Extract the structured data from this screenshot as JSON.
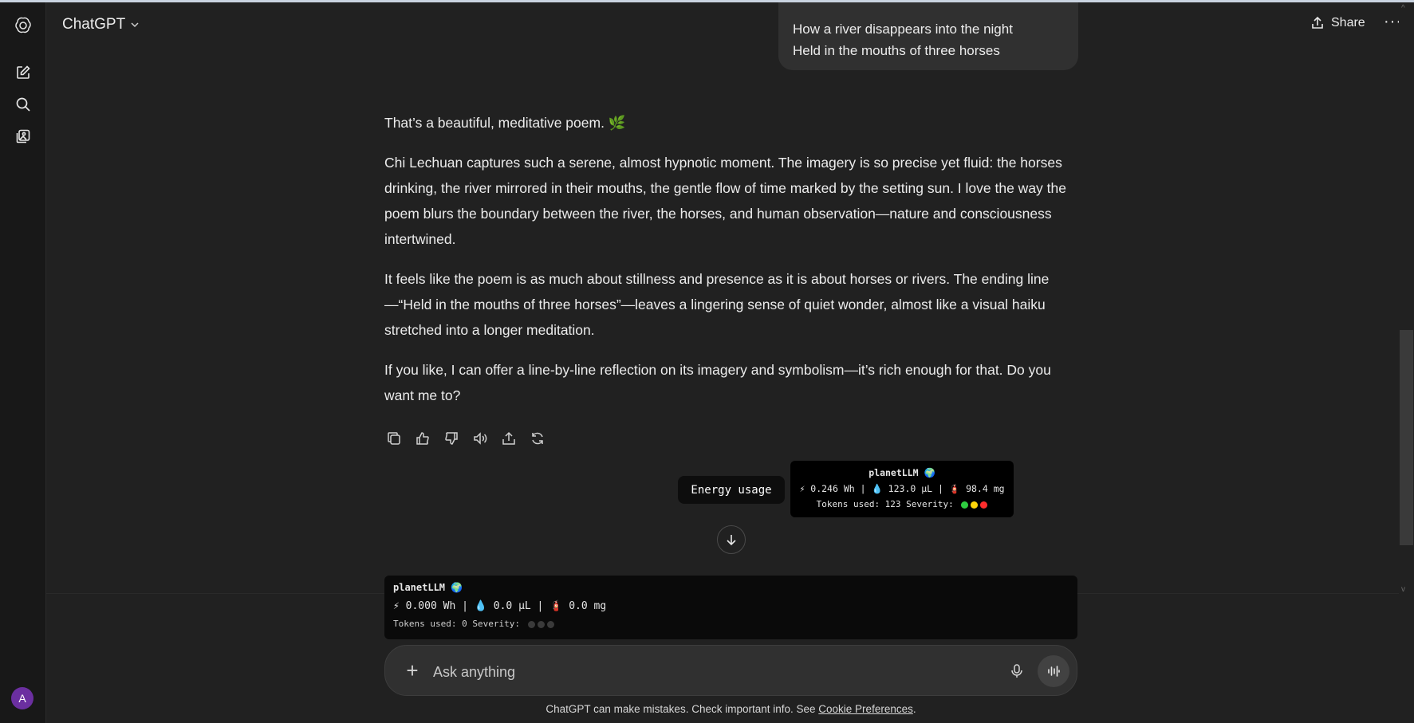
{
  "header": {
    "model_label": "ChatGPT",
    "share_label": "Share",
    "more_label": "···"
  },
  "user_message": {
    "lines": [
      "How a river disappears into the night",
      "Held in the mouths of three horses"
    ]
  },
  "assistant_message": {
    "p1": "That’s a beautiful, meditative poem. 🌿",
    "p2": "Chi Lechuan captures such a serene, almost hypnotic moment. The imagery is so precise yet fluid: the horses drinking, the river mirrored in their mouths, the gentle flow of time marked by the setting sun. I love the way the poem blurs the boundary between the river, the horses, and human observation—nature and consciousness intertwined.",
    "p3": "It feels like the poem is as much about stillness and presence as it is about horses or rivers. The ending line —“Held in the mouths of three horses”—leaves a lingering sense of quiet wonder, almost like a visual haiku stretched into a longer meditation.",
    "p4": "If you like, I can offer a line-by-line reflection on its imagery and symbolism—it’s rich enough for that. Do you want me to?"
  },
  "tooltip": {
    "label": "Energy usage"
  },
  "popup": {
    "title": "planetLLM 🌍",
    "metrics": "⚡ 0.246 Wh | 💧 123.0 µL | 🧯 98.4 mg",
    "tokens": "Tokens used: 123  Severity:",
    "severity_colors": [
      "#2ecc40",
      "#ffd60a",
      "#ff2d2d"
    ]
  },
  "planetbar": {
    "title": "planetLLM 🌍",
    "metrics": "⚡ 0.000 Wh | 💧 0.0 µL | 🧯 0.0 mg",
    "tokens": "Tokens used: 0 Severity:",
    "severity_colors": [
      "#3a3a3a",
      "#3a3a3a",
      "#3a3a3a"
    ]
  },
  "composer": {
    "placeholder": "Ask anything",
    "plus_label": "+"
  },
  "footer": {
    "text": "ChatGPT can make mistakes. Check important info. See ",
    "link": "Cookie Preferences",
    "end": "."
  },
  "user": {
    "avatar_initial": "A"
  }
}
